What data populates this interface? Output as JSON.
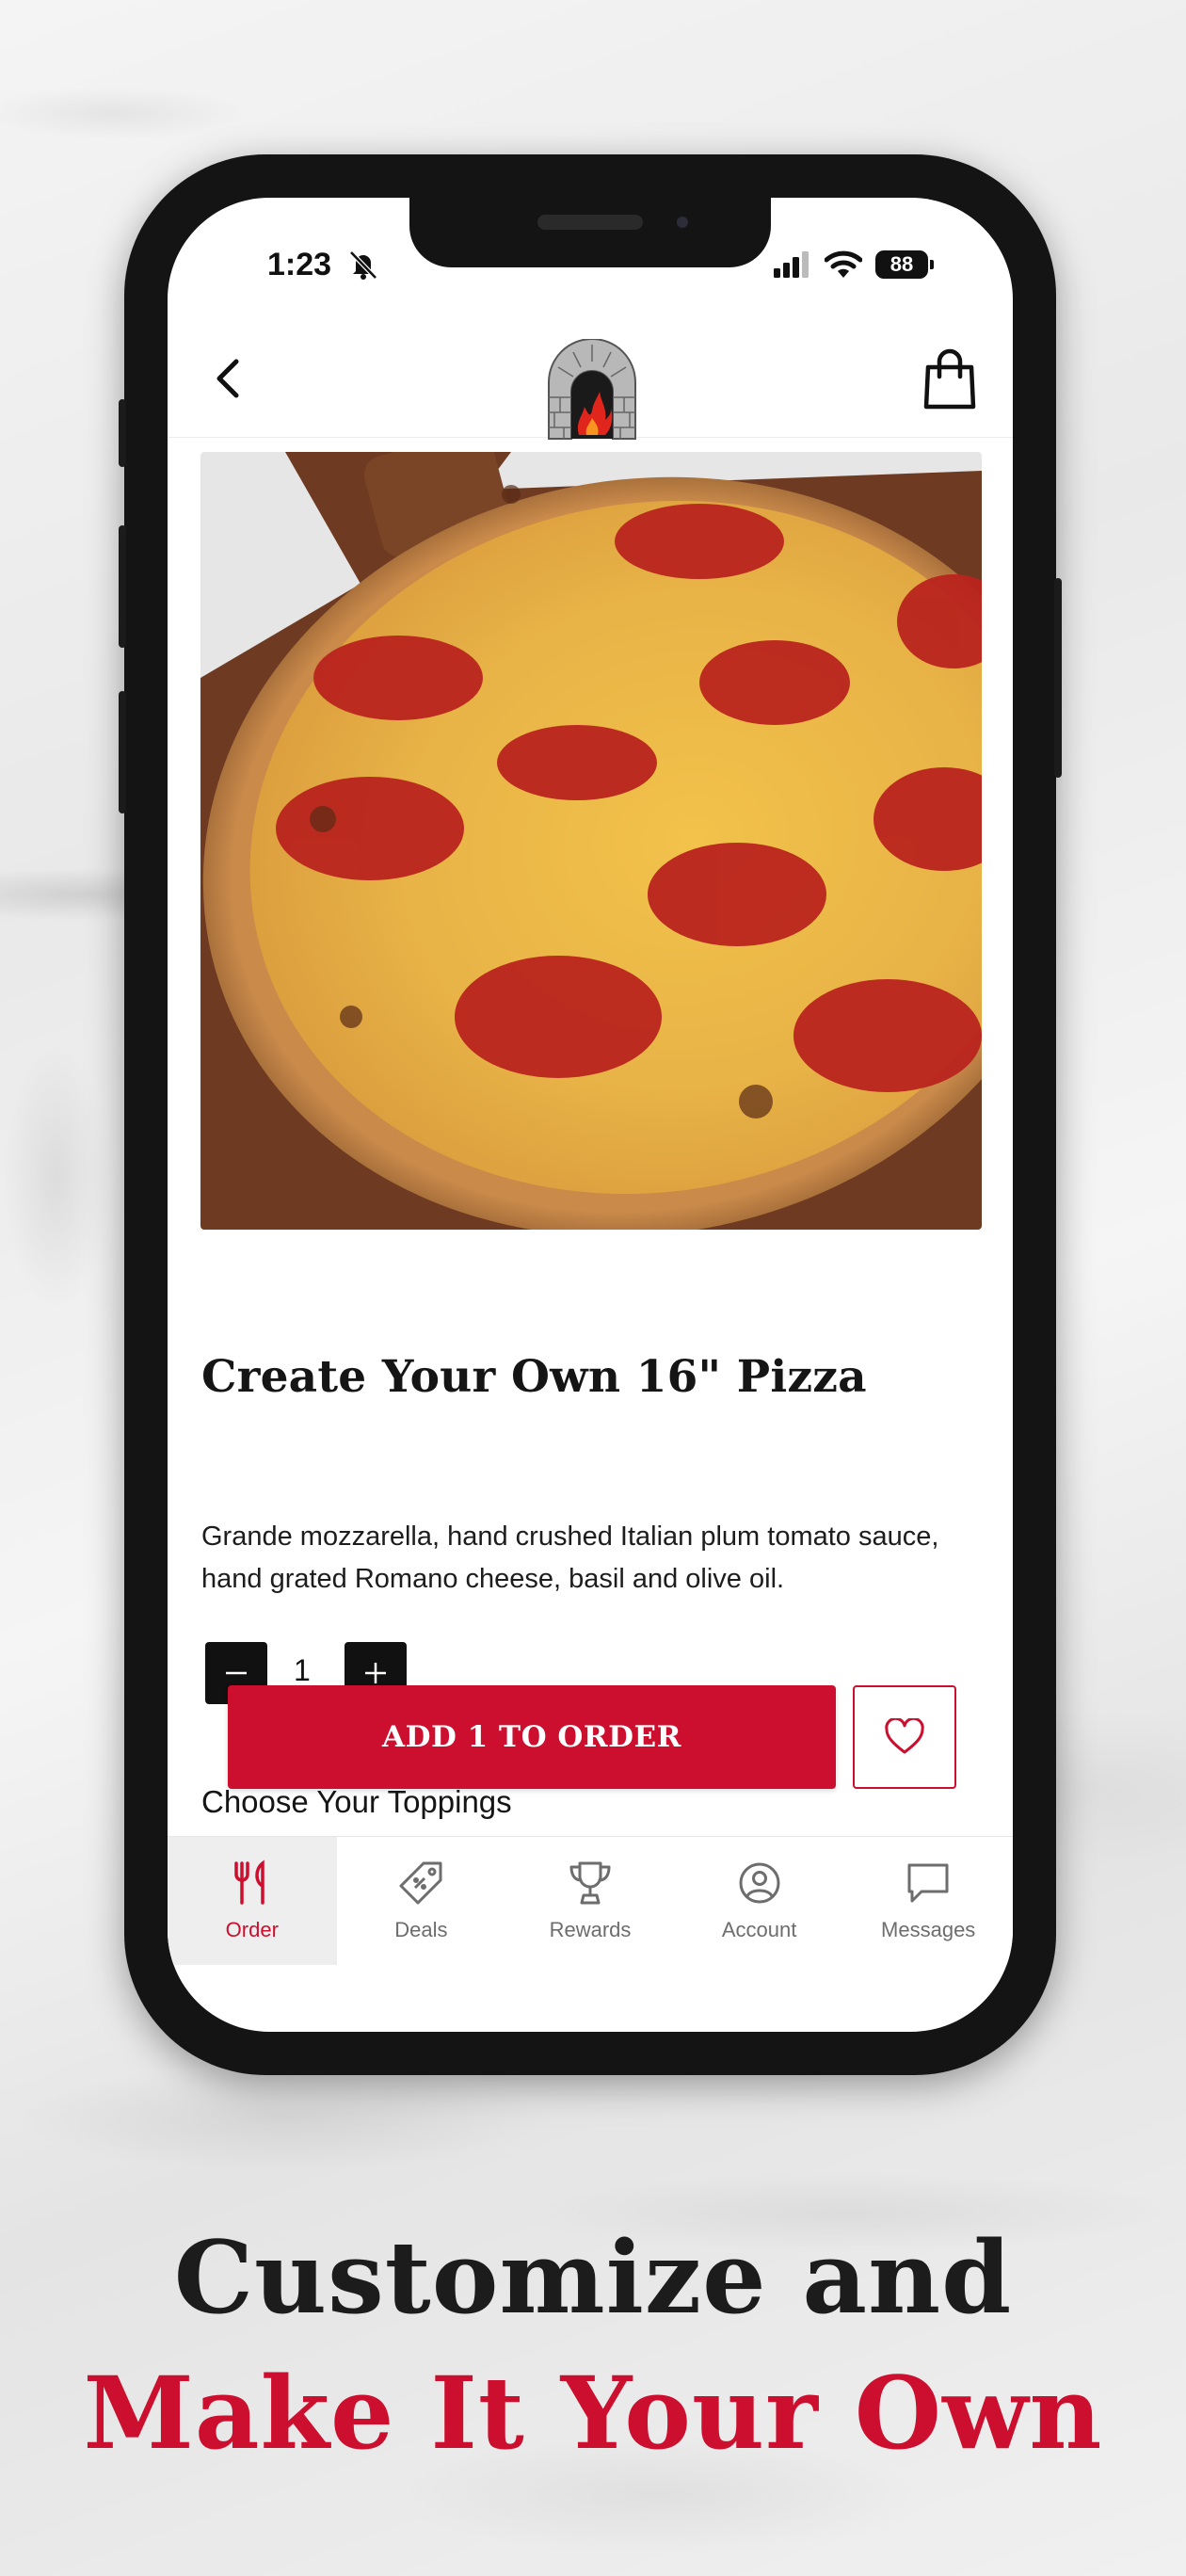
{
  "status_bar": {
    "time": "1:23",
    "battery": "88"
  },
  "header": {
    "back_icon": "chevron-left-icon",
    "logo_icon": "brick-oven-logo",
    "bag_icon": "shopping-bag-icon"
  },
  "product": {
    "title": "Create Your Own 16\" Pizza",
    "description": "Grande mozzarella, hand crushed Italian plum tomato sauce, hand grated Romano cheese, basil and olive oil.",
    "quantity": "1",
    "add_button_label": "ADD 1 TO ORDER",
    "toppings_heading": "Choose Your Toppings"
  },
  "bottom_nav": {
    "items": [
      {
        "label": "Order",
        "icon": "fork-knife-icon",
        "active": true
      },
      {
        "label": "Deals",
        "icon": "tag-icon",
        "active": false
      },
      {
        "label": "Rewards",
        "icon": "trophy-icon",
        "active": false
      },
      {
        "label": "Account",
        "icon": "user-circle-icon",
        "active": false
      },
      {
        "label": "Messages",
        "icon": "message-icon",
        "active": false
      }
    ]
  },
  "headline": {
    "line1": "Customize and",
    "line2": "Make It Your Own"
  },
  "colors": {
    "brand_red": "#cc0f2e",
    "text_dark": "#151515"
  }
}
